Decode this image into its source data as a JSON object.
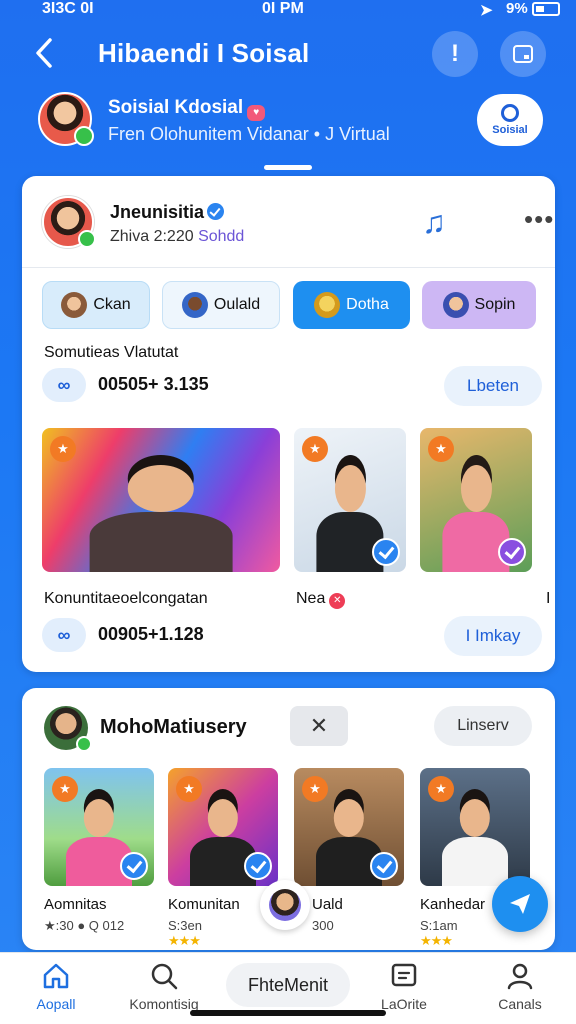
{
  "status_bar": {
    "time_left": "3I3C 0I",
    "time_center": "0I PM",
    "battery": "9%"
  },
  "header": {
    "title": "Hibaendi I Soisal",
    "alert_glyph": "!"
  },
  "community": {
    "name": "Soisial Kdosial",
    "subtitle": "Fren Olohunitem Vidanar  • J Virtual",
    "button_label": "Soisial"
  },
  "post": {
    "author": "Jneunisitia",
    "time": "Zhiva 2:220",
    "status": "Sohdd",
    "chips": [
      {
        "label": "Ckan"
      },
      {
        "label": "Oulald"
      },
      {
        "label": "Dotha"
      },
      {
        "label": "Sopin"
      }
    ],
    "section_title": "Somutieas Vlatutat",
    "count_1": "00505+ 3.135",
    "pill_1": "Lbeten",
    "photo_captions": [
      "Konuntitaeoelcongatan",
      "Nea",
      "I"
    ],
    "count_2": "00905+1.128",
    "pill_2": "I Imkay"
  },
  "group": {
    "name": "MohoMatiusery",
    "toggle_glyph": "✕",
    "pill": "Linserv",
    "members": [
      {
        "name": "Aomnitas",
        "stats": "★:30  ● Q 012"
      },
      {
        "name": "Komunitan",
        "stats": "S:3en",
        "stars": "★★★"
      },
      {
        "name": "Uald",
        "stats": "300"
      },
      {
        "name": "Kanhedar",
        "stats": "S:1am",
        "stars": "★★★"
      }
    ]
  },
  "tabbar": {
    "tabs": [
      {
        "label": "Aopall"
      },
      {
        "label": "Komontisig"
      },
      {
        "label": "LaOrite"
      },
      {
        "label": "Canals"
      }
    ],
    "center_label": "FhteMenit"
  }
}
